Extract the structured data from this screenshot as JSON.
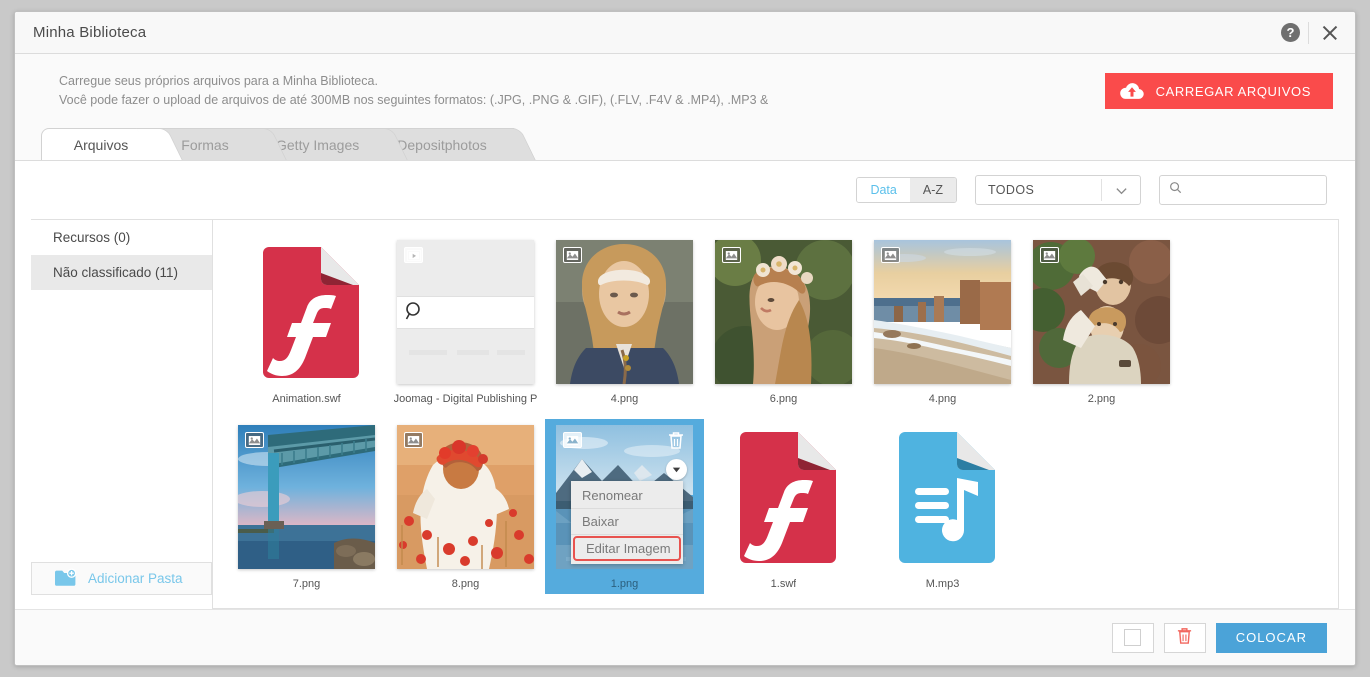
{
  "window": {
    "title": "Minha Biblioteca",
    "help_icon": "help-circle-icon",
    "close_icon": "close-icon"
  },
  "upload": {
    "line1": "Carregue seus próprios arquivos para a Minha Biblioteca.",
    "line2": "Você pode fazer o upload de arquivos de até 300MB nos seguintes formatos: (.JPG, .PNG & .GIF), (.FLV, .F4V & .MP4), .MP3 &",
    "button_label": "CARREGAR ARQUIVOS",
    "button_color": "#fa4b4b",
    "button_icon": "cloud-upload-icon"
  },
  "tabs": [
    {
      "label": "Arquivos",
      "active": true
    },
    {
      "label": "Formas",
      "active": false
    },
    {
      "label": "Getty Images",
      "active": false
    },
    {
      "label": "Depositphotos",
      "active": false
    }
  ],
  "filters": {
    "sort_date_label": "Data",
    "sort_az_label": "A-Z",
    "sort_active": "A-Z",
    "sort_link_color": "#5bc0eb",
    "type_select_value": "TODOS",
    "search_value": "",
    "search_placeholder": ""
  },
  "sidebar": {
    "items": [
      {
        "label": "Recursos (0)",
        "selected": false
      },
      {
        "label": "Não classificado (11)",
        "selected": true
      }
    ],
    "add_folder_label": "Adicionar Pasta",
    "add_folder_icon": "folder-plus-icon",
    "add_folder_color": "#79c7ea"
  },
  "files": [
    {
      "name": "Animation.swf",
      "kind": "flash",
      "badge": "",
      "selected": false
    },
    {
      "name": "Joomag - Digital Publishing P",
      "kind": "webpage",
      "badge": "video-icon",
      "selected": false
    },
    {
      "name": "4.png",
      "kind": "photo-woman-headband",
      "badge": "image-icon",
      "selected": false
    },
    {
      "name": "6.png",
      "kind": "photo-woman-flowers",
      "badge": "image-icon",
      "selected": false
    },
    {
      "name": "4.png",
      "kind": "photo-cliffs-sunset",
      "badge": "image-icon",
      "selected": false
    },
    {
      "name": "2.png",
      "kind": "photo-couple-leaves",
      "badge": "image-icon",
      "selected": false
    },
    {
      "name": "7.png",
      "kind": "photo-bridge",
      "badge": "image-icon",
      "selected": false
    },
    {
      "name": "8.png",
      "kind": "photo-girl-poppies",
      "badge": "image-icon",
      "selected": false
    },
    {
      "name": "1.png",
      "kind": "photo-mountains-lake",
      "badge": "image-icon",
      "selected": true
    },
    {
      "name": "1.swf",
      "kind": "flash",
      "badge": "",
      "selected": false
    },
    {
      "name": "M.mp3",
      "kind": "audio",
      "badge": "",
      "selected": false
    }
  ],
  "context_menu": {
    "visible": true,
    "items": [
      {
        "label": "Renomear",
        "highlighted": false
      },
      {
        "label": "Baixar",
        "highlighted": false
      },
      {
        "label": "Editar Imagem",
        "highlighted": true
      }
    ],
    "highlight_color": "#e8534f"
  },
  "selected_card_controls": {
    "delete_icon": "trash-icon",
    "dropdown_icon": "chevron-down-circle-icon",
    "selection_color": "#55ABDD"
  },
  "footer": {
    "checkbox_button_icon": "square-icon",
    "delete_button_icon": "trash-icon",
    "delete_icon_color": "#f2675f",
    "place_button_label": "COLOCAR",
    "place_button_color": "#4BA3D8"
  }
}
